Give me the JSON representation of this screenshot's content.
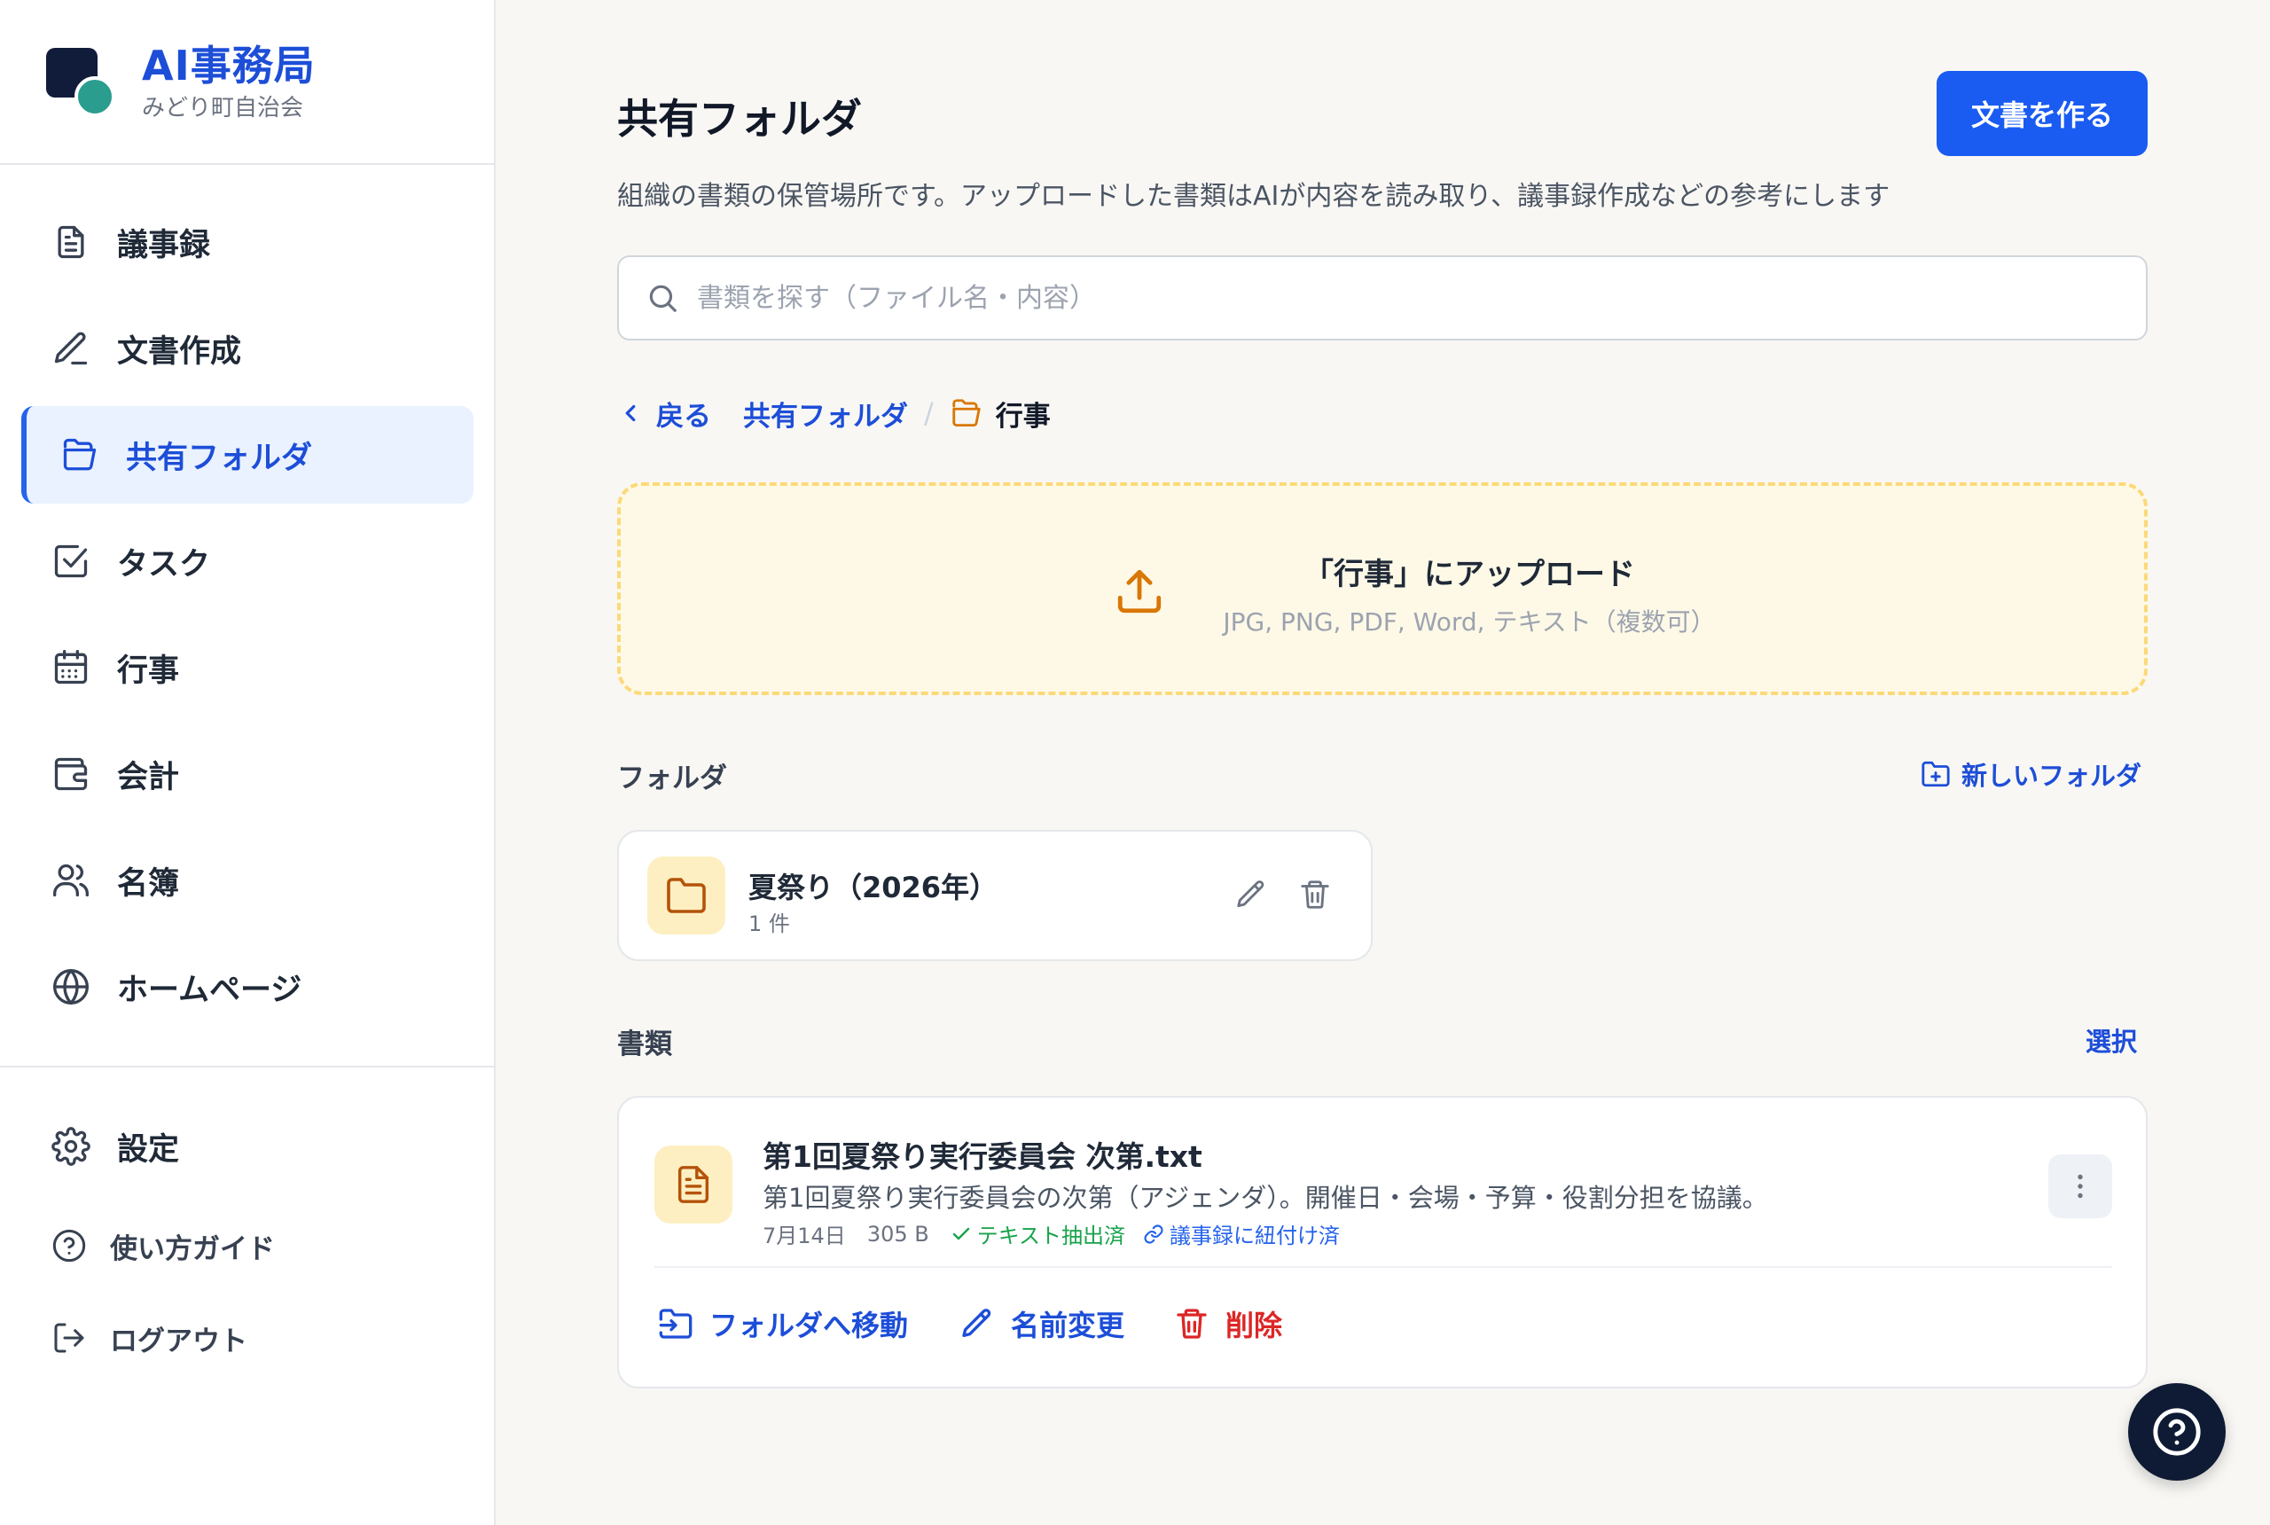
{
  "brand": {
    "title": "AI事務局",
    "subtitle": "みどり町自治会"
  },
  "sidebar": {
    "items": [
      {
        "label": "議事録",
        "icon": "document-icon"
      },
      {
        "label": "文書作成",
        "icon": "pen-icon"
      },
      {
        "label": "共有フォルダ",
        "icon": "folder-open-icon",
        "active": true
      },
      {
        "label": "タスク",
        "icon": "check-square-icon"
      },
      {
        "label": "行事",
        "icon": "calendar-icon"
      },
      {
        "label": "会計",
        "icon": "wallet-icon"
      },
      {
        "label": "名簿",
        "icon": "users-icon"
      },
      {
        "label": "ホームページ",
        "icon": "globe-icon"
      }
    ],
    "footer": [
      {
        "label": "設定",
        "icon": "gear-icon"
      },
      {
        "label": "使い方ガイド",
        "icon": "help-circle-icon"
      },
      {
        "label": "ログアウト",
        "icon": "logout-icon"
      }
    ]
  },
  "header": {
    "title": "共有フォルダ",
    "description": "組織の書類の保管場所です。アップロードした書類はAIが内容を読み取り、議事録作成などの参考にします",
    "create_button": "文書を作る"
  },
  "search": {
    "placeholder": "書類を探す（ファイル名・内容）",
    "value": ""
  },
  "breadcrumb": {
    "back": "戻る",
    "root": "共有フォルダ",
    "separator": "/",
    "current": "行事"
  },
  "upload": {
    "title": "「行事」にアップロード",
    "formats": "JPG, PNG, PDF, Word, テキスト（複数可）"
  },
  "folders_section": {
    "heading": "フォルダ",
    "new_folder": "新しいフォルダ",
    "items": [
      {
        "name": "夏祭り（2026年）",
        "count": "1 件"
      }
    ]
  },
  "documents_section": {
    "heading": "書類",
    "select": "選択",
    "items": [
      {
        "name": "第1回夏祭り実行委員会 次第.txt",
        "description": "第1回夏祭り実行委員会の次第（アジェンダ）。開催日・会場・予算・役割分担を協議。",
        "date": "7月14日",
        "size": "305 B",
        "tag_extracted": "テキスト抽出済",
        "tag_linked": "議事録に紐付け済",
        "actions": {
          "move": "フォルダへ移動",
          "rename": "名前変更",
          "delete": "削除"
        }
      }
    ]
  },
  "colors": {
    "accent": "#1a5cf2",
    "brand_text": "#1d4ed8",
    "danger": "#dc2626",
    "success": "#16a34a",
    "upload_bg": "#fef9e7",
    "upload_border": "#fcd978",
    "fab": "#0f1b34"
  }
}
